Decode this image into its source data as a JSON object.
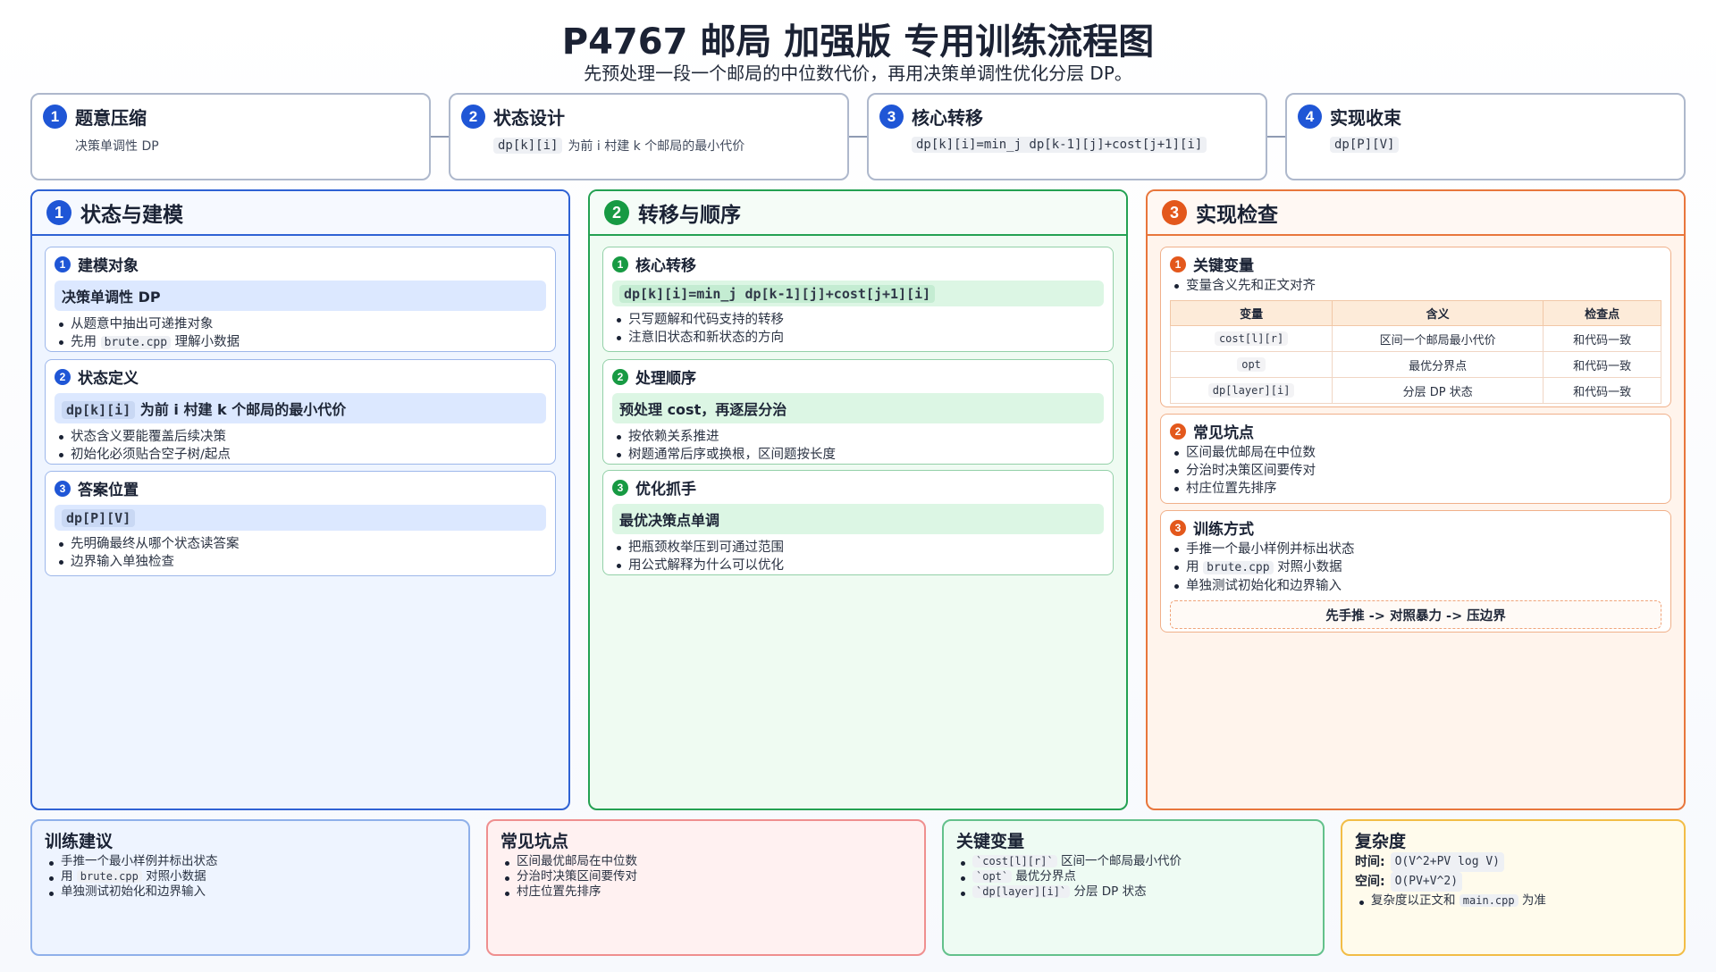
{
  "header": {
    "title": "P4767 邮局 加强版 专用训练流程图",
    "subtitle": "先预处理一段一个邮局的中位数代价，再用决策单调性优化分层 DP。"
  },
  "steps": [
    {
      "num": "1",
      "title": "题意压缩",
      "code": "",
      "text": "决策单调性 DP"
    },
    {
      "num": "2",
      "title": "状态设计",
      "code": "dp[k][i]",
      "text": "为前 i 村建 k 个邮局的最小代价"
    },
    {
      "num": "3",
      "title": "核心转移",
      "code": "dp[k][i]=min_j dp[k-1][j]+cost[j+1][i]",
      "text": ""
    },
    {
      "num": "4",
      "title": "实现收束",
      "code": "dp[P][V]",
      "text": ""
    }
  ],
  "col1": {
    "num": "1",
    "title": "状态与建模",
    "cards": [
      {
        "num": "1",
        "title": "建模对象",
        "hl_code": "",
        "hl_text": "决策单调性 DP",
        "bullets": [
          "从题意中抽出可递推对象"
        ],
        "b2_pre": "先用",
        "b2_code": "brute.cpp",
        "b2_post": "理解小数据"
      },
      {
        "num": "2",
        "title": "状态定义",
        "hl_code": "dp[k][i]",
        "hl_text": "为前 i 村建 k 个邮局的最小代价",
        "bullets": [
          "状态含义要能覆盖后续决策",
          "初始化必须贴合空子树/起点"
        ]
      },
      {
        "num": "3",
        "title": "答案位置",
        "hl_code": "dp[P][V]",
        "hl_text": "",
        "bullets": [
          "先明确最终从哪个状态读答案",
          "边界输入单独检查"
        ]
      }
    ]
  },
  "col2": {
    "num": "2",
    "title": "转移与顺序",
    "cards": [
      {
        "num": "1",
        "title": "核心转移",
        "hl_code": "dp[k][i]=min_j dp[k-1][j]+cost[j+1][i]",
        "hl_text": "",
        "bullets": [
          "只写题解和代码支持的转移",
          "注意旧状态和新状态的方向"
        ]
      },
      {
        "num": "2",
        "title": "处理顺序",
        "hl_code": "",
        "hl_text": "预处理 cost，再逐层分治",
        "bullets": [
          "按依赖关系推进",
          "树题通常后序或换根，区间题按长度"
        ]
      },
      {
        "num": "3",
        "title": "优化抓手",
        "hl_code": "",
        "hl_text": "最优决策点单调",
        "bullets": [
          "把瓶颈枚举压到可通过范围",
          "用公式解释为什么可以优化"
        ]
      }
    ]
  },
  "col3": {
    "num": "3",
    "title": "实现检查",
    "card1": {
      "num": "1",
      "title": "关键变量",
      "bullets": [
        "变量含义先和正文对齐"
      ],
      "table": {
        "headers": [
          "变量",
          "含义",
          "检查点"
        ],
        "rows": [
          [
            "cost[l][r]",
            "区间一个邮局最小代价",
            "和代码一致"
          ],
          [
            "opt",
            "最优分界点",
            "和代码一致"
          ],
          [
            "dp[layer][i]",
            "分层 DP 状态",
            "和代码一致"
          ]
        ]
      }
    },
    "card2": {
      "num": "2",
      "title": "常见坑点",
      "bullets": [
        "区间最优邮局在中位数",
        "分治时决策区间要传对",
        "村庄位置先排序"
      ]
    },
    "card3": {
      "num": "3",
      "title": "训练方式",
      "b1": "手推一个最小样例并标出状态",
      "b2_pre": "用",
      "b2_code": "brute.cpp",
      "b2_post": "对照小数据",
      "b3": "单独测试初始化和边界输入",
      "flow": "先手推 -> 对照暴力 -> 压边界"
    }
  },
  "notes": {
    "training": {
      "title": "训练建议",
      "b1": "手推一个最小样例并标出状态",
      "b2_pre": "用",
      "b2_code": "brute.cpp",
      "b2_post": "对照小数据",
      "b3": "单独测试初始化和边界输入"
    },
    "pitfalls": {
      "title": "常见坑点",
      "items": [
        "区间最优邮局在中位数",
        "分治时决策区间要传对",
        "村庄位置先排序"
      ]
    },
    "variables": {
      "title": "关键变量",
      "items": [
        {
          "code": "`cost[l][r]`",
          "text": "区间一个邮局最小代价"
        },
        {
          "code": "`opt`",
          "text": "最优分界点"
        },
        {
          "code": "`dp[layer][i]`",
          "text": "分层 DP 状态"
        }
      ]
    },
    "complexity": {
      "title": "复杂度",
      "time_label": "时间:",
      "time_value": "O(V^2+PV log V)",
      "space_label": "空间:",
      "space_value": "O(PV+V^2)",
      "b_pre": "复杂度以正文和",
      "b_code": "main.cpp",
      "b_post": "为准"
    }
  },
  "colors": {
    "blue": "#1f56d6",
    "green": "#179a43",
    "orange": "#e3581c",
    "red": "#ef8f8f",
    "yellow": "#f2bd46"
  }
}
